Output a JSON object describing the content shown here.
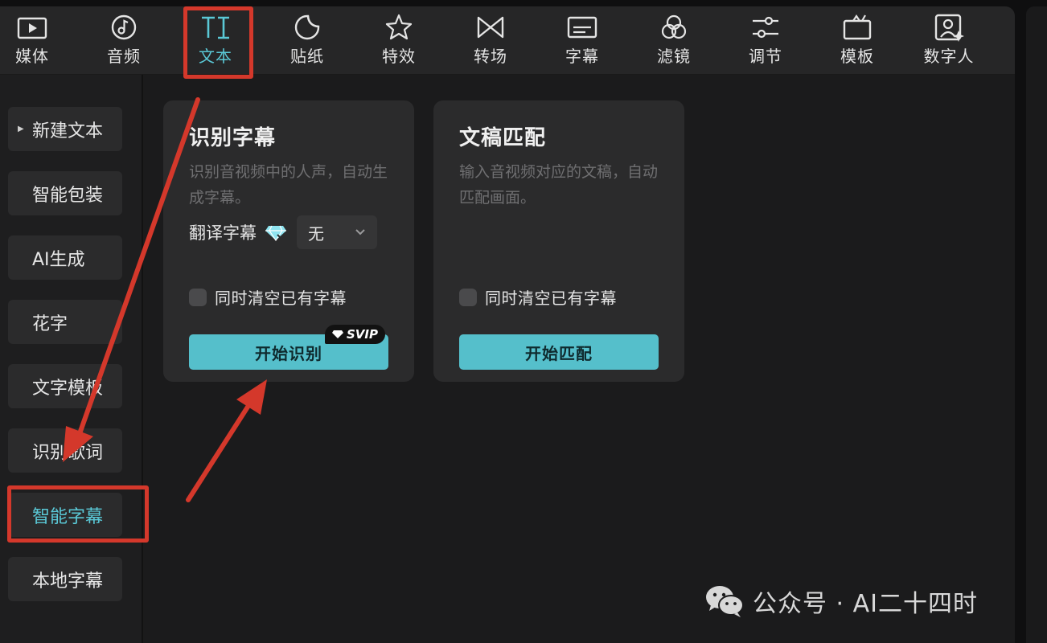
{
  "toolbar": {
    "items": [
      {
        "label": "媒体",
        "icon": "media-icon"
      },
      {
        "label": "音频",
        "icon": "audio-note-icon"
      },
      {
        "label": "文本",
        "icon": "text-ti-icon",
        "active": true
      },
      {
        "label": "贴纸",
        "icon": "sticker-icon"
      },
      {
        "label": "特效",
        "icon": "effects-star-icon"
      },
      {
        "label": "转场",
        "icon": "transition-bowtie-icon"
      },
      {
        "label": "字幕",
        "icon": "subtitle-icon"
      },
      {
        "label": "滤镜",
        "icon": "filter-circles-icon"
      },
      {
        "label": "调节",
        "icon": "adjust-sliders-icon"
      },
      {
        "label": "模板",
        "icon": "template-icon"
      },
      {
        "label": "数字人",
        "icon": "digital-human-icon"
      }
    ]
  },
  "sidebar": {
    "items": [
      {
        "label": "新建文本",
        "has_caret": true
      },
      {
        "label": "智能包装"
      },
      {
        "label": "AI生成"
      },
      {
        "label": "花字"
      },
      {
        "label": "文字模板"
      },
      {
        "label": "识别歌词"
      },
      {
        "label": "智能字幕",
        "active": true
      },
      {
        "label": "本地字幕"
      }
    ]
  },
  "cards": {
    "recognize": {
      "title": "识别字幕",
      "description": "识别音视频中的人声，自动生成字幕。",
      "translate_label": "翻译字幕",
      "translate_value": "无",
      "clear_label": "同时清空已有字幕",
      "button_label": "开始识别",
      "badge": "SVIP"
    },
    "match": {
      "title": "文稿匹配",
      "description": "输入音视频对应的文稿，自动匹配画面。",
      "clear_label": "同时清空已有字幕",
      "button_label": "开始匹配"
    }
  },
  "watermark": {
    "text": "公众号 · AI二十四时",
    "icon": "wechat-icon"
  },
  "colors": {
    "accent": "#55bfcb",
    "active_text": "#5ac8d6",
    "annotation": "#d4382b",
    "panel_bg": "#2b2b2c",
    "app_bg": "#1e1e1f"
  }
}
